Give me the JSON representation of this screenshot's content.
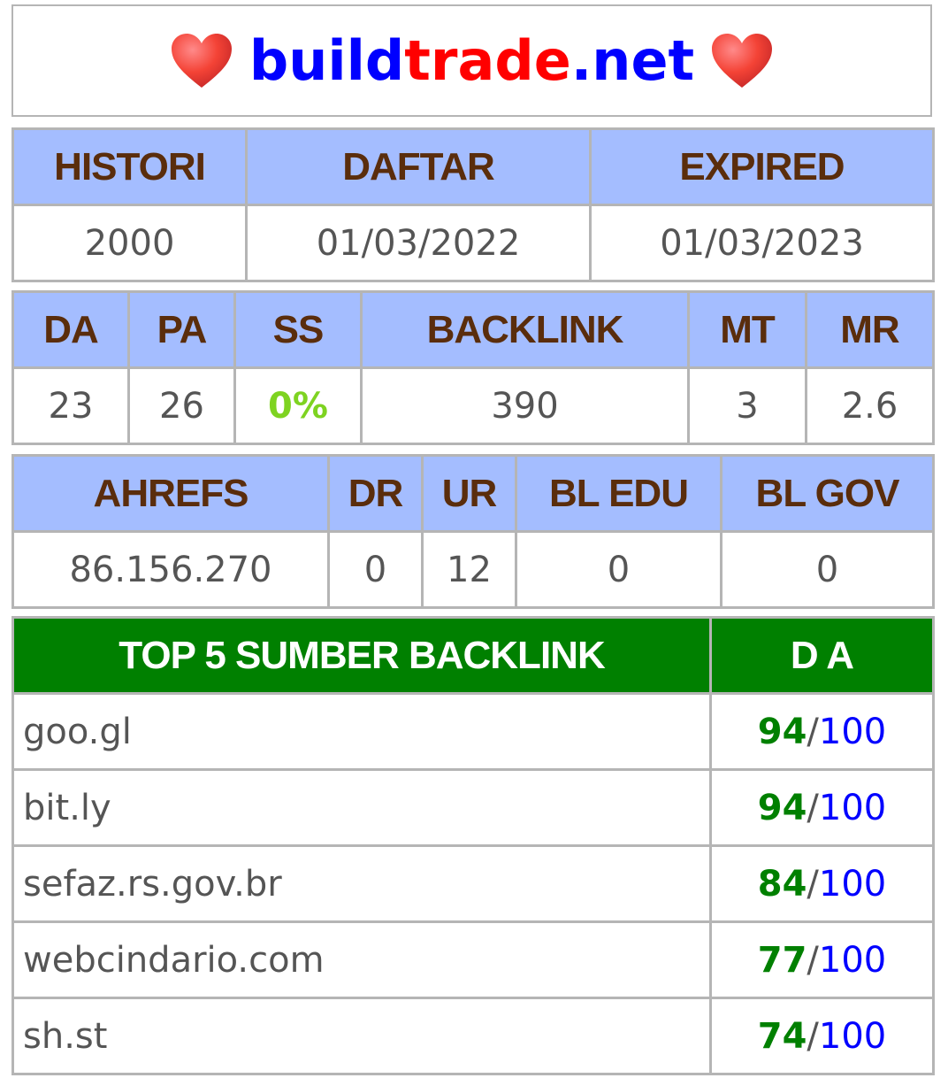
{
  "title": {
    "part1": "build",
    "part2": "trade",
    "part3": ".net"
  },
  "colors": {
    "header_bg": "#a4bdff",
    "header_text": "#5a2d0c",
    "top_header_bg": "#008000",
    "blue": "#0000ff",
    "red": "#ff0000",
    "green": "#008000",
    "ss_green": "#7ed321"
  },
  "icons": {
    "left": "heart-icon",
    "right": "heart-icon"
  },
  "table1": {
    "headers": [
      "HISTORI",
      "DAFTAR",
      "EXPIRED"
    ],
    "values": [
      "2000",
      "01/03/2022",
      "01/03/2023"
    ]
  },
  "table2": {
    "headers": [
      "DA",
      "PA",
      "SS",
      "BACKLINK",
      "MT",
      "MR"
    ],
    "values": [
      "23",
      "26",
      "0%",
      "390",
      "3",
      "2.6"
    ]
  },
  "table3": {
    "headers": [
      "AHREFS",
      "DR",
      "UR",
      "BL EDU",
      "BL GOV"
    ],
    "values": [
      "86.156.270",
      "0",
      "12",
      "0",
      "0"
    ]
  },
  "top5": {
    "headers": [
      "TOP 5 SUMBER BACKLINK",
      "D A"
    ],
    "rows": [
      {
        "site": "goo.gl",
        "da": "94",
        "sep": "/",
        "max": "100"
      },
      {
        "site": "bit.ly",
        "da": "94",
        "sep": "/",
        "max": "100"
      },
      {
        "site": "sefaz.rs.gov.br",
        "da": "84",
        "sep": "/",
        "max": "100"
      },
      {
        "site": "webcindario.com",
        "da": "77",
        "sep": "/",
        "max": "100"
      },
      {
        "site": "sh.st",
        "da": "74",
        "sep": "/",
        "max": "100"
      }
    ]
  }
}
